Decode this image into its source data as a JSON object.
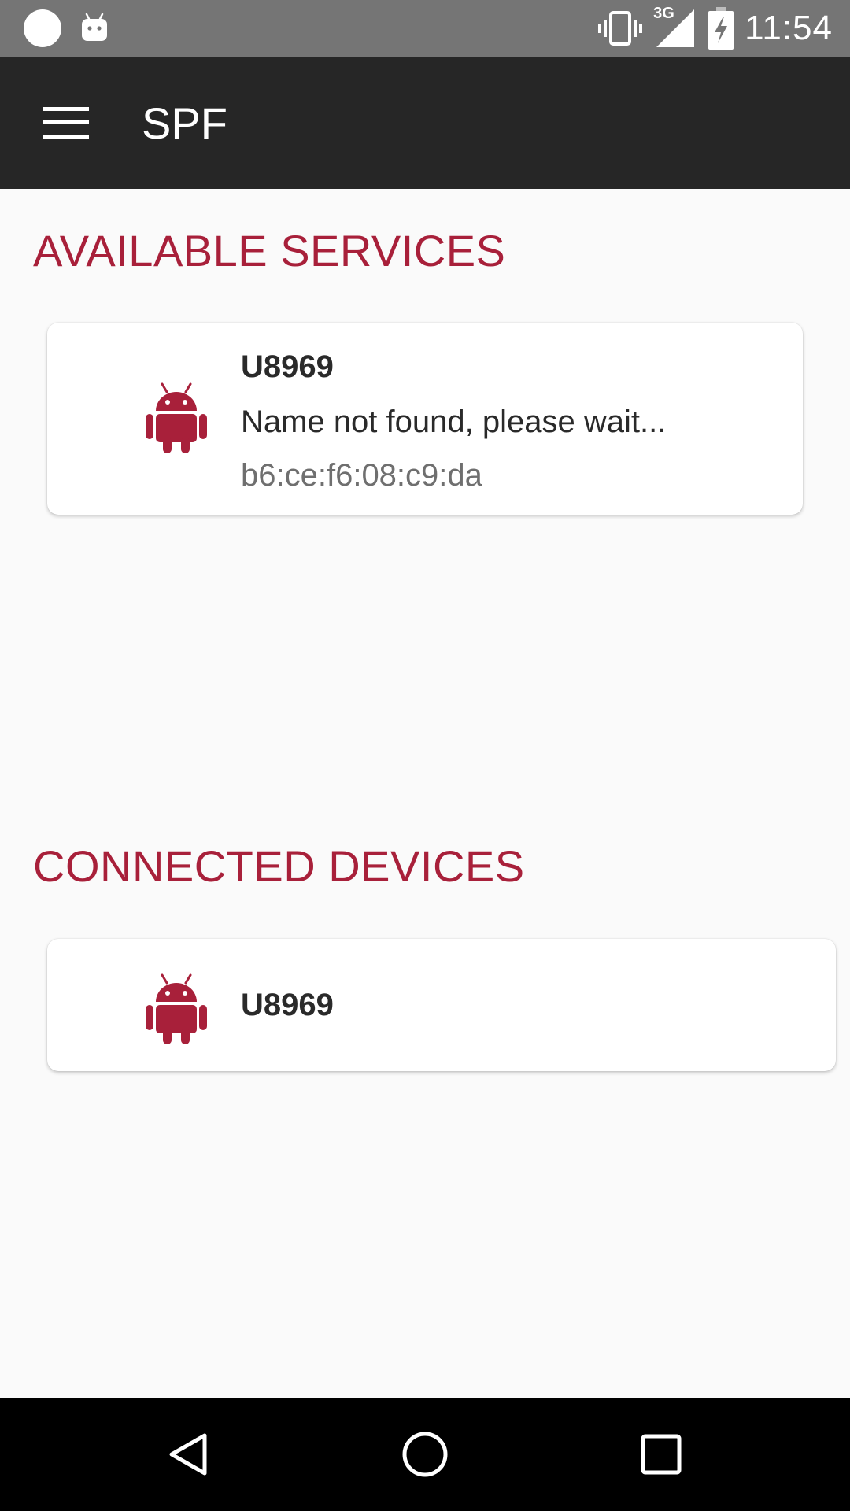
{
  "status_bar": {
    "time": "11:54",
    "network": "3G",
    "icons": [
      "notification-dot-icon",
      "android-notification-icon",
      "vibrate-icon",
      "signal-icon",
      "battery-charging-icon"
    ]
  },
  "app_bar": {
    "title": "SPF",
    "menu_icon": "hamburger-menu-icon"
  },
  "available_services": {
    "header": "AVAILABLE SERVICES",
    "items": [
      {
        "name": "U8969",
        "status": "Name not found, please wait...",
        "mac": "b6:ce:f6:08:c9:da",
        "icon": "android-icon"
      }
    ]
  },
  "connected_devices": {
    "header": "CONNECTED DEVICES",
    "items": [
      {
        "name": "U8969",
        "icon": "android-icon"
      }
    ]
  },
  "nav_bar": {
    "buttons": [
      "back-icon",
      "home-icon",
      "recents-icon"
    ]
  },
  "colors": {
    "accent": "#a8203a",
    "status_bar": "#757575",
    "app_bar": "#262626",
    "background": "#fafafa"
  }
}
